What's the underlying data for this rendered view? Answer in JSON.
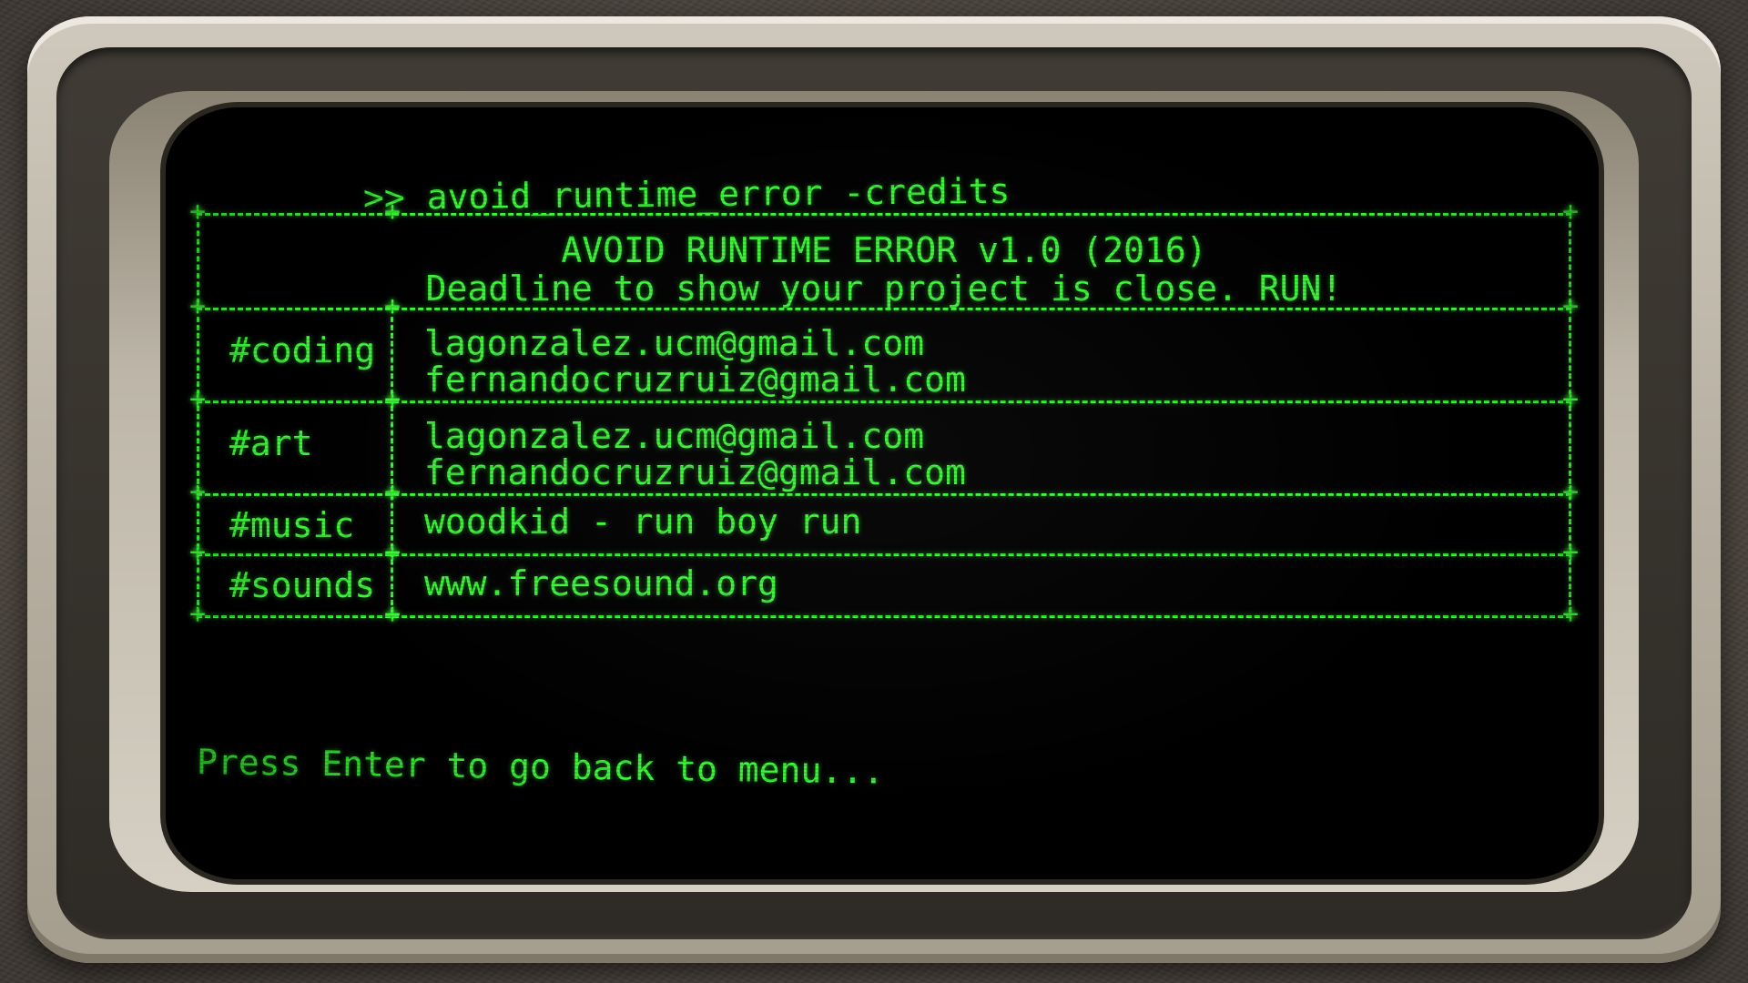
{
  "terminal": {
    "prompt_symbol": ">>",
    "command": "avoid_runtime_error -credits",
    "footer": "Press Enter to go back to menu..."
  },
  "credits": {
    "title": "AVOID RUNTIME ERROR v1.0 (2016)",
    "subtitle": "Deadline to show your project is close. RUN!",
    "rows": [
      {
        "label": "#coding",
        "values": [
          "lagonzalez.ucm@gmail.com",
          "fernandocruzruiz@gmail.com"
        ]
      },
      {
        "label": "#art",
        "values": [
          "lagonzalez.ucm@gmail.com",
          "fernandocruzruiz@gmail.com"
        ]
      },
      {
        "label": "#music",
        "values": [
          "woodkid - run boy run"
        ]
      },
      {
        "label": "#sounds",
        "values": [
          "www.freesound.org"
        ]
      }
    ]
  },
  "colors": {
    "terminal_green": "#3df53a",
    "screen_background": "#000000",
    "frame_beige": "#c4bdb0"
  }
}
